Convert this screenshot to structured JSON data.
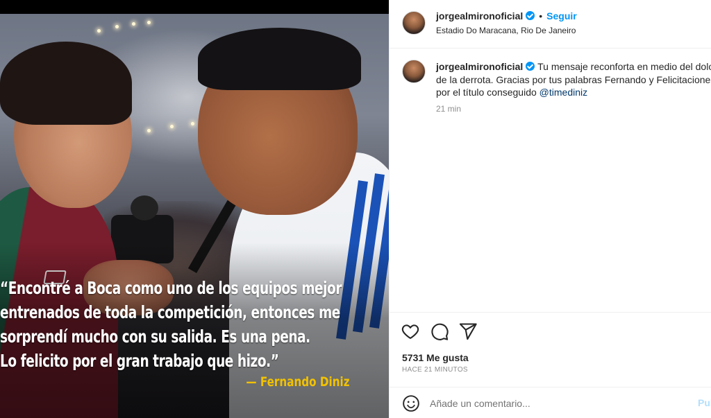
{
  "post": {
    "username": "jorgealmironoficial",
    "follow_label": "Seguir",
    "separator": "•",
    "location": "Estadio Do Maracana, Rio De Janeiro"
  },
  "media": {
    "quote_lines": [
      "“Encontré a Boca como uno de los equipos mejor",
      "entrenados de toda la competición, entonces me",
      "sorprendí mucho con su salida. Es una pena.",
      "Lo felicito por el gran trabajo que hizo.”"
    ],
    "author": "— Fernando Diniz"
  },
  "caption": {
    "username": "jorgealmironoficial",
    "lines": [
      "Tu mensaje reconforta en medio del dolor",
      "de la derrota. Gracias por tus palabras Fernando y Felicitaciones",
      "por el título conseguido"
    ],
    "mention": "@timediniz",
    "time": "21 min"
  },
  "actions": {
    "icons": [
      "heart-icon",
      "comment-icon",
      "share-icon"
    ],
    "likes": "5731 Me gusta",
    "posted": "HACE 21 MINUTOS"
  },
  "add_comment": {
    "placeholder": "Añade un comentario...",
    "publish_label": "Publicar"
  },
  "colors": {
    "accent": "#0095f6",
    "mention": "#00376b",
    "quote_author": "#f2c200",
    "muted": "#8e8e8e"
  }
}
